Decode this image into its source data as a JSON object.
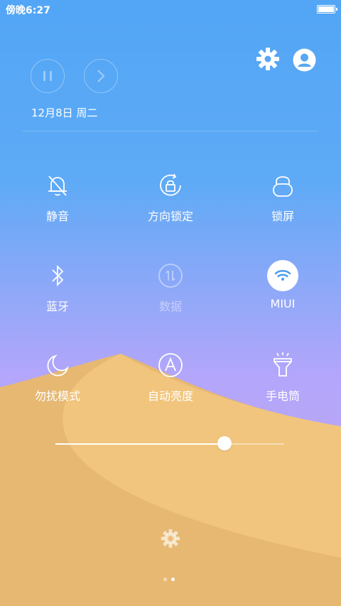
{
  "status_bar": {
    "time": "傍晚6:27"
  },
  "header": {
    "date": "12月8日 周二"
  },
  "toggles": [
    {
      "label": "静音",
      "icon": "silent-bell-icon",
      "active": false,
      "disabled": false
    },
    {
      "label": "方向锁定",
      "icon": "rotation-lock-icon",
      "active": false,
      "disabled": false
    },
    {
      "label": "锁屏",
      "icon": "lock-icon",
      "active": false,
      "disabled": false
    },
    {
      "label": "蓝牙",
      "icon": "bluetooth-icon",
      "active": false,
      "disabled": false
    },
    {
      "label": "数据",
      "icon": "mobile-data-icon",
      "active": false,
      "disabled": true
    },
    {
      "label": "MIUI",
      "icon": "wifi-icon",
      "active": true,
      "disabled": false
    },
    {
      "label": "勿扰模式",
      "icon": "moon-icon",
      "active": false,
      "disabled": false
    },
    {
      "label": "自动亮度",
      "icon": "auto-brightness-icon",
      "active": false,
      "disabled": false
    },
    {
      "label": "手电筒",
      "icon": "flashlight-icon",
      "active": false,
      "disabled": false
    }
  ],
  "brightness": {
    "level": 0.74
  },
  "pager": {
    "pages": 2,
    "current": 2
  },
  "colors": {
    "sky_top": "#52a6f5",
    "sky_bottom": "#b8a6f6",
    "sand_dark": "#e6b872",
    "sand_light": "#f1c57d",
    "active_wifi": "#4a9df0"
  }
}
